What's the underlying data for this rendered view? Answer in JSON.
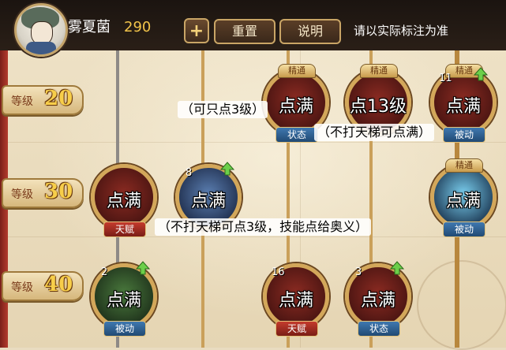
{
  "player": {
    "name": "雾夏菌",
    "currency": "290"
  },
  "toolbar": {
    "plus_symbol": "+",
    "reset_label": "重置",
    "help_label": "说明"
  },
  "notice": "请以实际标注为准",
  "levels": [
    {
      "label": "等级",
      "number": "20"
    },
    {
      "label": "等级",
      "number": "30"
    },
    {
      "label": "等级",
      "number": "40"
    }
  ],
  "skills": {
    "l20_a": {
      "text": "点满",
      "tag": "状态",
      "badge": "精通"
    },
    "l20_b": {
      "text": "点13级",
      "badge": "精通"
    },
    "l20_c": {
      "text": "点满",
      "count": "11",
      "tag": "被动",
      "badge": "精通"
    },
    "l30_a": {
      "text": "点满",
      "tag": "天赋"
    },
    "l30_b": {
      "text": "点满",
      "count": "8"
    },
    "l30_c": {
      "text": "点满",
      "tag": "被动",
      "badge": "精通"
    },
    "l40_a": {
      "text": "点满",
      "count": "2",
      "tag": "被动"
    },
    "l40_b": {
      "text": "点满",
      "count": "16",
      "tag": "天赋"
    },
    "l40_c": {
      "text": "点满",
      "count": "3",
      "tag": "状态"
    }
  },
  "annotations": {
    "left20": "（可只点3级）",
    "below20": "（不打天梯可点满）",
    "below30": "（不打天梯可点3级，技能点给奥义）"
  },
  "colors": {
    "accent_gold": "#d3a75a",
    "tag_blue": "#214a74",
    "tag_red": "#7a1d16"
  }
}
